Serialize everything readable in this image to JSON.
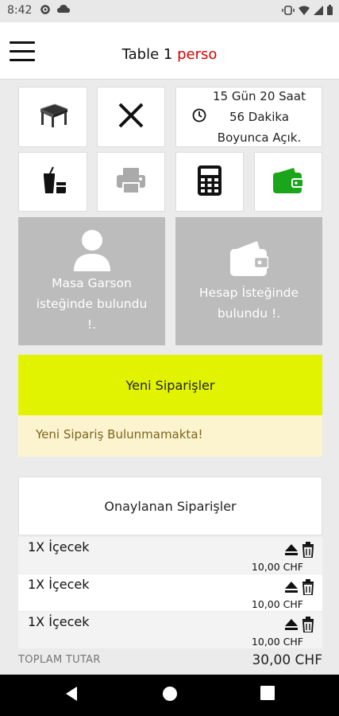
{
  "status_bar": {
    "time": "8:42",
    "left_icons": [
      "gear-icon",
      "cloud-icon"
    ],
    "right_icons": [
      "vibrate-icon",
      "wifi-icon",
      "signal-icon",
      "battery-icon"
    ]
  },
  "header": {
    "title_main": "Table 1",
    "title_accent": "perso",
    "accent_color": "#d40000"
  },
  "actions": {
    "table_icon": "table-icon",
    "close_icon": "close-icon",
    "timer_text_1": "15 Gün 20 Saat",
    "timer_text_2": "56 Dakika",
    "timer_text_3": "Boyunca Açık.",
    "drink_icon": "drink-icon",
    "print_icon": "printer-icon",
    "calc_icon": "calculator-icon",
    "wallet_icon": "wallet-icon",
    "wallet_color": "#1aa51a"
  },
  "notifications": {
    "waiter_line_1": "Masa Garson",
    "waiter_line_2": "isteğinde bulundu",
    "waiter_line_3": "!.",
    "bill_line_1": "Hesap İsteğinde",
    "bill_line_2": "bulundu !."
  },
  "new_orders": {
    "title": "Yeni Siparişler",
    "empty_message": "Yeni Sipariş Bulunmamakta!",
    "highlight_color": "#e2f300"
  },
  "approved_orders": {
    "title": "Onaylanan Siparişler",
    "items": [
      {
        "name": "1X İçecek",
        "price": "10,00 CHF"
      },
      {
        "name": "1X İçecek",
        "price": "10,00 CHF"
      },
      {
        "name": "1X İçecek",
        "price": "10,00 CHF"
      }
    ]
  },
  "total": {
    "label": "TOPLAM TUTAR",
    "value": "30,00 CHF"
  }
}
